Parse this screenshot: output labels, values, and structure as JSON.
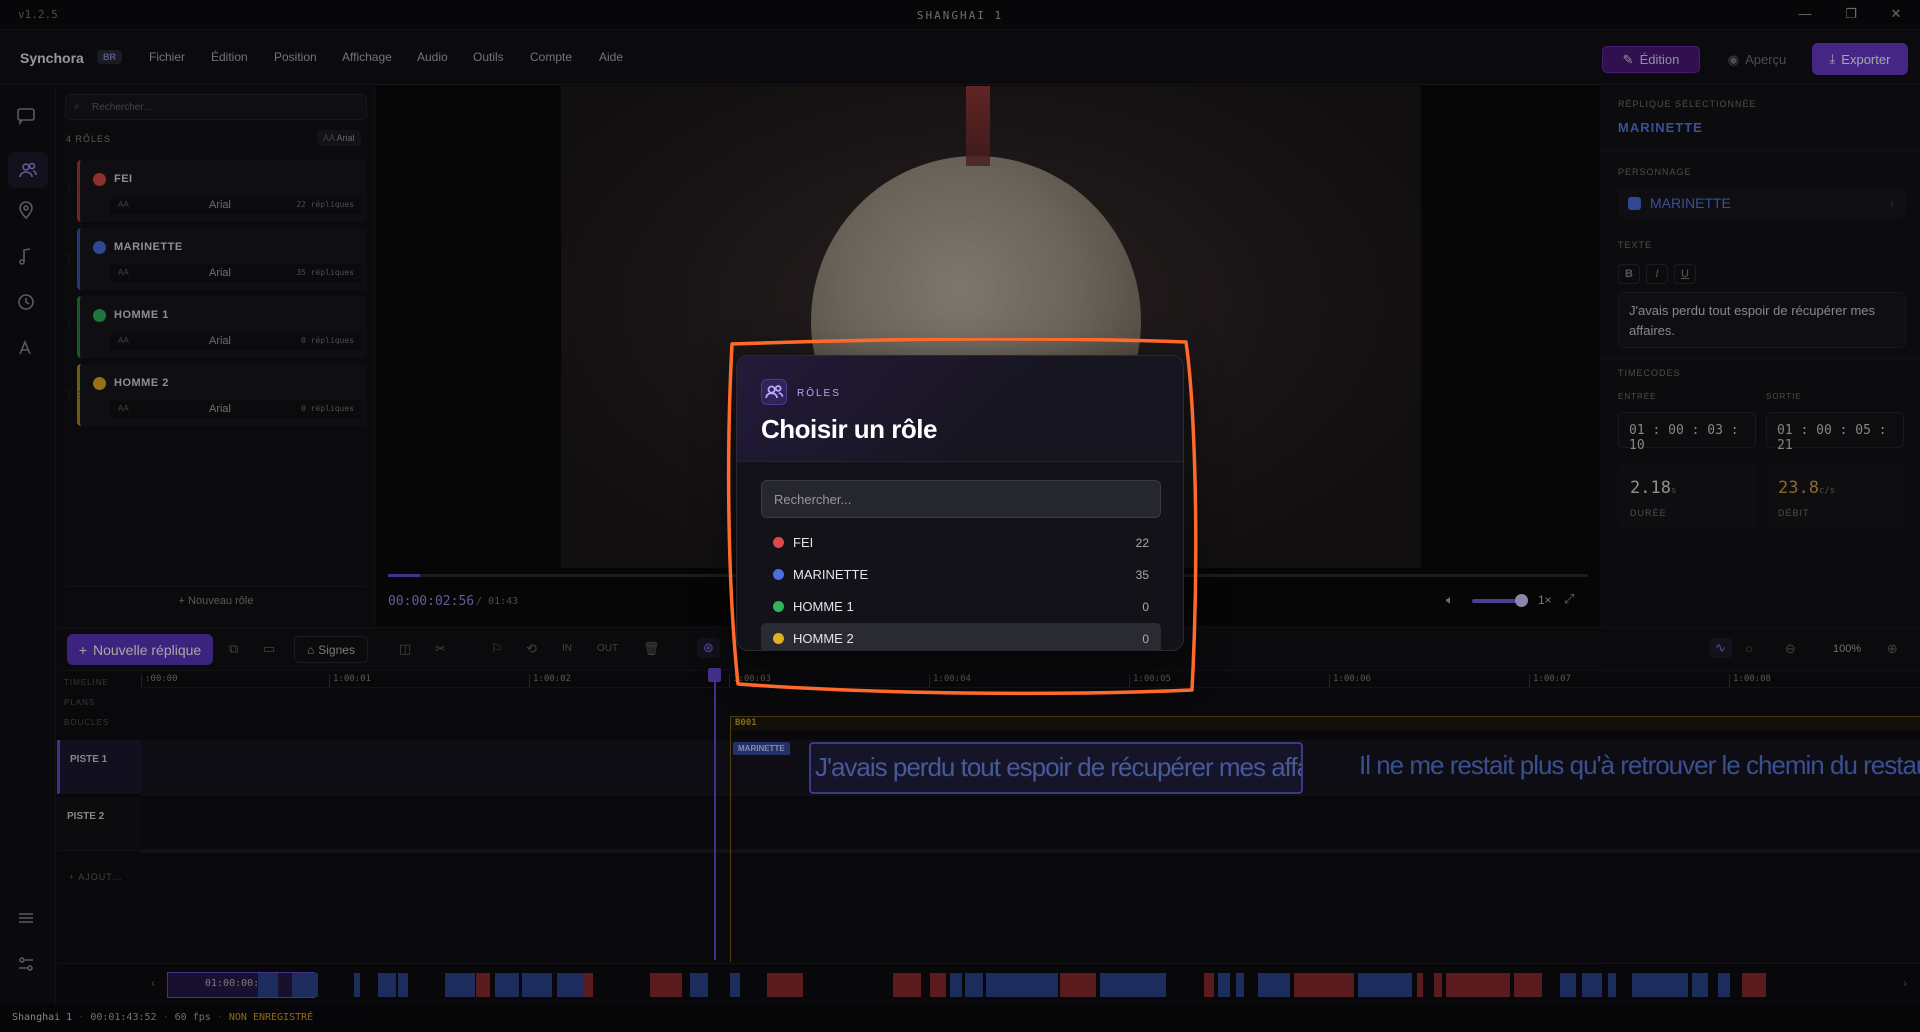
{
  "app": {
    "version": "v1.2.5",
    "window_title": "SHANGHAI 1",
    "brand": "Synchora",
    "brand_badge": "BR",
    "menu": [
      "Fichier",
      "Édition",
      "Position",
      "Affichage",
      "Audio",
      "Outils",
      "Compte",
      "Aide"
    ],
    "mode_edition": "Édition",
    "mode_apercu": "Aperçu",
    "export": "Exporter"
  },
  "roles_panel": {
    "search_placeholder": "Rechercher...",
    "count_label": "4 RÔLES",
    "font_button": "Arial",
    "new_role": "+ Nouveau rôle",
    "roles": [
      {
        "name": "FEI",
        "color": "#e04848",
        "font": "Arial",
        "aa": "AA",
        "replies": "22 répliques"
      },
      {
        "name": "MARINETTE",
        "color": "#4b6ee0",
        "font": "Arial",
        "aa": "AA",
        "replies": "35 répliques"
      },
      {
        "name": "HOMME 1",
        "color": "#2fb55a",
        "font": "Arial",
        "aa": "AA",
        "replies": "0 répliques"
      },
      {
        "name": "HOMME 2",
        "color": "#e0b020",
        "font": "Arial",
        "aa": "AA",
        "replies": "0 répliques"
      }
    ]
  },
  "player": {
    "current_time": "00:00:02:56",
    "separator": "/",
    "total_time": "01:43",
    "speed": "1×",
    "progress": 0.027,
    "volume": 0.9
  },
  "inspector": {
    "selected_label": "RÉPLIQUE SÉLECTIONNÉE",
    "selected_name": "MARINETTE",
    "character_label": "PERSONNAGE",
    "character_name": "MARINETTE",
    "text_label": "TEXTE",
    "bold": "B",
    "italic": "I",
    "underline": "U",
    "text": "J'avais perdu tout espoir de récupérer mes affaires.",
    "timecodes_label": "TIMECODES",
    "in_label": "ENTRÉE",
    "out_label": "SORTIE",
    "in_tc": "01 : 00 : 03 : 10",
    "out_tc": "01 : 00 : 05 : 21",
    "duration_value": "2.18",
    "duration_unit": "s",
    "duration_label": "DURÉE",
    "rate_value": "23.8",
    "rate_unit": "c/s",
    "rate_label": "DÉBIT"
  },
  "toolbar": {
    "new_reply": "Nouvelle réplique",
    "signes": "Signes",
    "in": "IN",
    "out": "OUT",
    "zoom": "100%"
  },
  "timeline": {
    "labels": [
      "TIMELINE",
      "PLANS",
      "BOUCLES"
    ],
    "ticks": [
      ":00:00",
      "1:00:01",
      "1:00:02",
      "1:00:03",
      "1:00:04",
      "1:00:05",
      "1:00:06",
      "1:00:07",
      "1:00:08"
    ],
    "tracks": [
      "PISTE 1",
      "PISTE 2"
    ],
    "add_track": "+ AJOUT…",
    "shot_label": "B001",
    "sub_tag": "MARINETTE",
    "sub1": "J'avais perdu tout espoir de récupérer mes affaires.",
    "sub2": "Il ne me restait plus qu'à retrouver le chemin du restaurant d"
  },
  "minimap": {
    "timecode": "01:00:00:02"
  },
  "statusbar": {
    "project": "Shanghai 1",
    "duration": "00:01:43:52",
    "fps": "60 fps",
    "state": "NON ENREGISTRÉ"
  },
  "modal": {
    "eyebrow": "RÔLES",
    "title": "Choisir un rôle",
    "search_placeholder": "Rechercher...",
    "options": [
      {
        "name": "FEI",
        "color": "#e04848",
        "count": "22"
      },
      {
        "name": "MARINETTE",
        "color": "#4b6ee0",
        "count": "35"
      },
      {
        "name": "HOMME 1",
        "color": "#2fb55a",
        "count": "0"
      },
      {
        "name": "HOMME 2",
        "color": "#e0b020",
        "count": "0"
      }
    ],
    "highlighted_option": "HOMME 2"
  },
  "colors": {
    "accent": "#6b4ad8",
    "annotation": "#ff6a2a"
  }
}
